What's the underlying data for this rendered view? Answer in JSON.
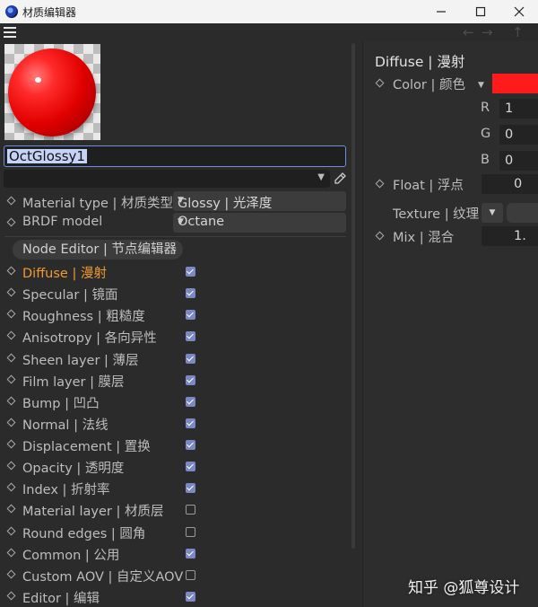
{
  "window": {
    "title": "材质编辑器"
  },
  "material": {
    "name": "OctGlossy1",
    "sub_value": ""
  },
  "properties": {
    "material_type": {
      "label": "Material type | 材质类型",
      "value": "Glossy | 光泽度"
    },
    "brdf_model": {
      "label": "BRDF model",
      "value": "Octane"
    }
  },
  "node_editor_label": "Node Editor | 节点编辑器",
  "channels": [
    {
      "label": "Diffuse | 漫射",
      "checked": true,
      "active": true
    },
    {
      "label": "Specular | 镜面",
      "checked": true,
      "active": false
    },
    {
      "label": "Roughness | 粗糙度",
      "checked": true,
      "active": false
    },
    {
      "label": "Anisotropy | 各向异性",
      "checked": true,
      "active": false
    },
    {
      "label": "Sheen layer | 薄层",
      "checked": true,
      "active": false
    },
    {
      "label": "Film layer | 膜层",
      "checked": true,
      "active": false
    },
    {
      "label": "Bump | 凹凸",
      "checked": true,
      "active": false
    },
    {
      "label": "Normal | 法线",
      "checked": true,
      "active": false
    },
    {
      "label": "Displacement | 置换",
      "checked": true,
      "active": false
    },
    {
      "label": "Opacity | 透明度",
      "checked": true,
      "active": false
    },
    {
      "label": "Index | 折射率",
      "checked": true,
      "active": false
    },
    {
      "label": "Material layer | 材质层",
      "checked": false,
      "active": false
    },
    {
      "label": "Round edges | 圆角",
      "checked": false,
      "active": false
    },
    {
      "label": "Common | 公用",
      "checked": true,
      "active": false
    },
    {
      "label": "Custom AOV | 自定义AOV",
      "checked": false,
      "active": false
    },
    {
      "label": "Editor | 编辑",
      "checked": true,
      "active": false
    }
  ],
  "diffuse_panel": {
    "title": "Diffuse | 漫射",
    "color_label": "Color | 颜色",
    "color_hex": "#ff1b1b",
    "r_label": "R",
    "r_value": "1",
    "g_label": "G",
    "g_value": "0",
    "b_label": "B",
    "b_value": "0",
    "float_label": "Float | 浮点",
    "float_value": "0",
    "texture_label": "Texture | 纹理",
    "mix_label": "Mix | 混合",
    "mix_value": "1."
  },
  "watermark": "知乎 @狐尊设计",
  "colors": {
    "accent_active": "#f09a32",
    "checkbox": "#7c88c4",
    "selection": "#c6d3f7",
    "focus_border": "#6f8ee0"
  }
}
